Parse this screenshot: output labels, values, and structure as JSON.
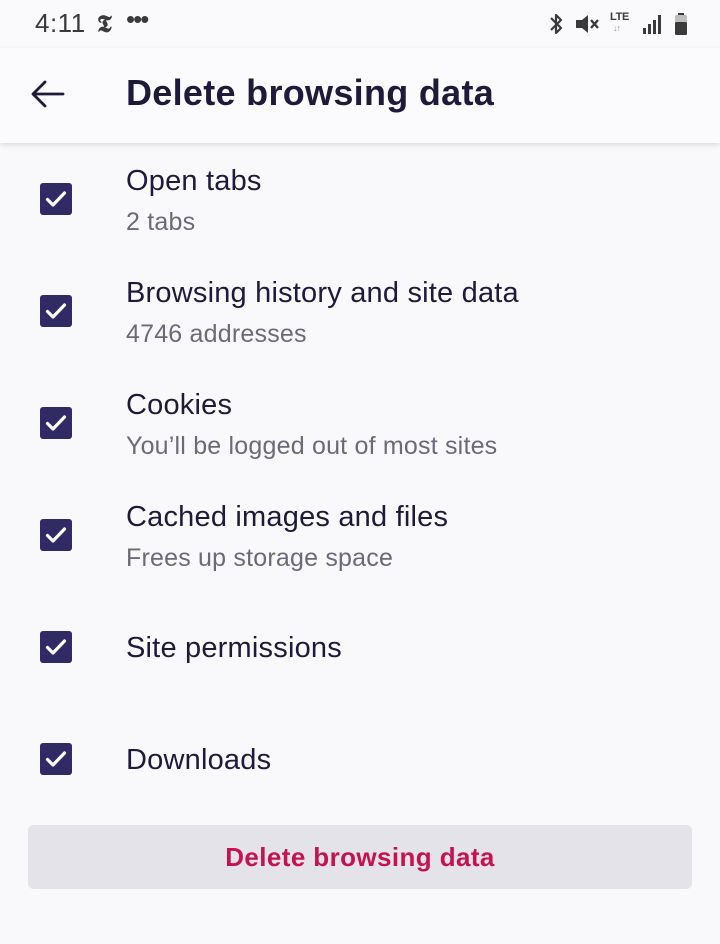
{
  "status_bar": {
    "time": "4:11",
    "app_glyph": "𝕿",
    "more_dots": "•••",
    "network_label": "LTE",
    "network_arrows": "↓↑",
    "icons": [
      "bluetooth-icon",
      "vibrate-mute-icon",
      "lte-icon",
      "signal-icon",
      "battery-icon"
    ]
  },
  "header": {
    "back_icon": "arrow-left-icon",
    "title": "Delete browsing data"
  },
  "options": [
    {
      "title": "Open tabs",
      "subtitle": "2 tabs",
      "checked": true
    },
    {
      "title": "Browsing history and site data",
      "subtitle": "4746 addresses",
      "checked": true
    },
    {
      "title": "Cookies",
      "subtitle": "You’ll be logged out of most sites",
      "checked": true
    },
    {
      "title": "Cached images and files",
      "subtitle": "Frees up storage space",
      "checked": true
    },
    {
      "title": "Site permissions",
      "subtitle": "",
      "checked": true
    },
    {
      "title": "Downloads",
      "subtitle": "",
      "checked": true
    }
  ],
  "action": {
    "label": "Delete browsing data"
  },
  "colors": {
    "accent": "#312a65",
    "danger": "#c4134e",
    "text_primary": "#1d1a3a",
    "text_secondary": "#6c6a78",
    "button_bg": "#e4e3e9"
  }
}
